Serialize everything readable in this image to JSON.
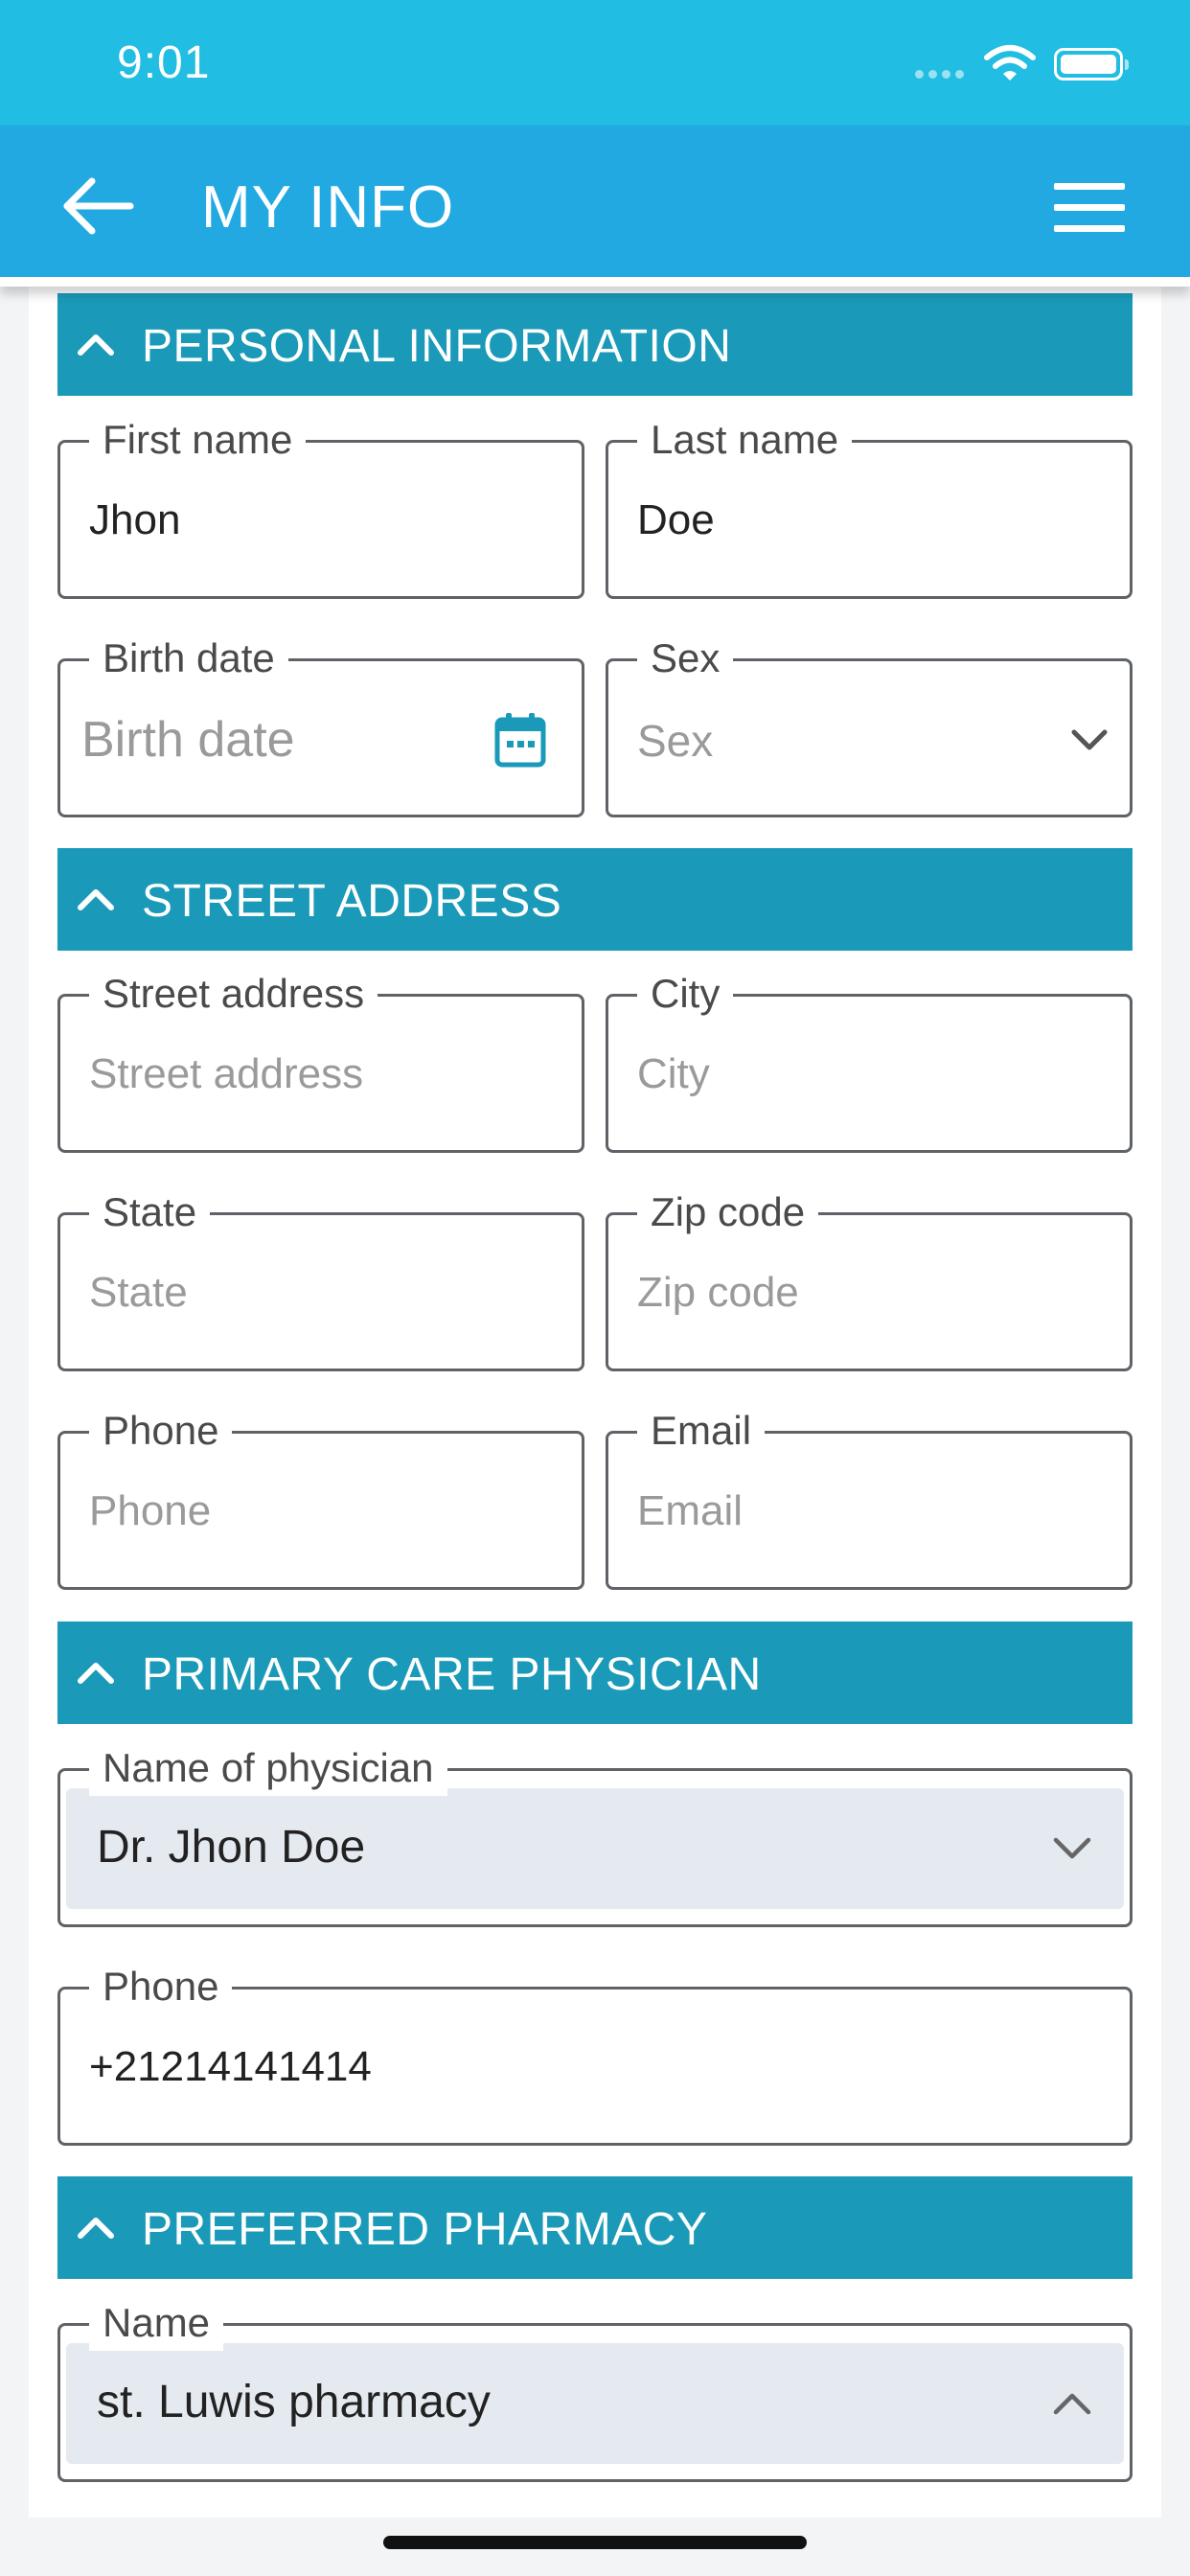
{
  "status_bar": {
    "time": "9:01"
  },
  "header": {
    "title": "MY INFO"
  },
  "sections": {
    "personal": {
      "title": "PERSONAL INFORMATION"
    },
    "address": {
      "title": "STREET ADDRESS"
    },
    "physician": {
      "title": "PRIMARY CARE PHYSICIAN"
    },
    "pharmacy": {
      "title": "PREFERRED PHARMACY"
    }
  },
  "fields": {
    "first_name": {
      "label": "First name",
      "value": "Jhon"
    },
    "last_name": {
      "label": "Last name",
      "value": "Doe"
    },
    "birth_date": {
      "label": "Birth date",
      "placeholder": "Birth date"
    },
    "sex": {
      "label": "Sex",
      "placeholder": "Sex"
    },
    "street": {
      "label": "Street address",
      "placeholder": "Street address"
    },
    "city": {
      "label": "City",
      "placeholder": "City"
    },
    "state": {
      "label": "State",
      "placeholder": "State"
    },
    "zip": {
      "label": "Zip code",
      "placeholder": "Zip code"
    },
    "phone": {
      "label": "Phone",
      "placeholder": "Phone"
    },
    "email": {
      "label": "Email",
      "placeholder": "Email"
    },
    "physician_name": {
      "label": "Name of physician",
      "value": "Dr. Jhon Doe"
    },
    "physician_phone": {
      "label": "Phone",
      "value": "+21214141414"
    },
    "pharmacy_name": {
      "label": "Name",
      "value": "st. Luwis pharmacy"
    }
  },
  "colors": {
    "status_bar": "#21bde2",
    "header": "#22a9e1",
    "section_header": "#1a9ab8",
    "select_bg": "#e5eaf0"
  },
  "icons": [
    "back-arrow-icon",
    "hamburger-menu-icon",
    "chevron-up-icon",
    "calendar-icon",
    "chevron-down-icon",
    "wifi-icon",
    "battery-icon"
  ]
}
